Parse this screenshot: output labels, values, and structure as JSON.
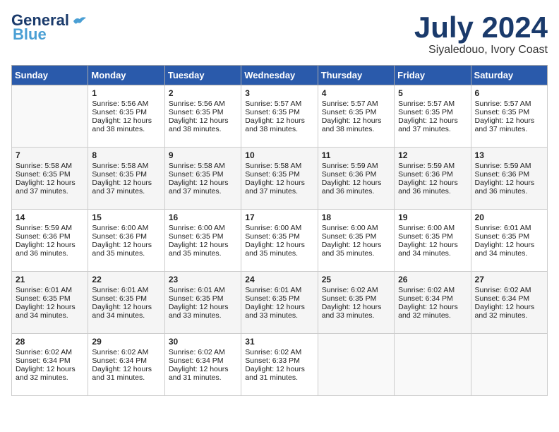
{
  "header": {
    "logo_line1": "General",
    "logo_line2": "Blue",
    "month": "July 2024",
    "location": "Siyaledouo, Ivory Coast"
  },
  "weekdays": [
    "Sunday",
    "Monday",
    "Tuesday",
    "Wednesday",
    "Thursday",
    "Friday",
    "Saturday"
  ],
  "weeks": [
    [
      {
        "day": "",
        "sunrise": "",
        "sunset": "",
        "daylight": ""
      },
      {
        "day": "1",
        "sunrise": "Sunrise: 5:56 AM",
        "sunset": "Sunset: 6:35 PM",
        "daylight": "Daylight: 12 hours and 38 minutes."
      },
      {
        "day": "2",
        "sunrise": "Sunrise: 5:56 AM",
        "sunset": "Sunset: 6:35 PM",
        "daylight": "Daylight: 12 hours and 38 minutes."
      },
      {
        "day": "3",
        "sunrise": "Sunrise: 5:57 AM",
        "sunset": "Sunset: 6:35 PM",
        "daylight": "Daylight: 12 hours and 38 minutes."
      },
      {
        "day": "4",
        "sunrise": "Sunrise: 5:57 AM",
        "sunset": "Sunset: 6:35 PM",
        "daylight": "Daylight: 12 hours and 38 minutes."
      },
      {
        "day": "5",
        "sunrise": "Sunrise: 5:57 AM",
        "sunset": "Sunset: 6:35 PM",
        "daylight": "Daylight: 12 hours and 37 minutes."
      },
      {
        "day": "6",
        "sunrise": "Sunrise: 5:57 AM",
        "sunset": "Sunset: 6:35 PM",
        "daylight": "Daylight: 12 hours and 37 minutes."
      }
    ],
    [
      {
        "day": "7",
        "sunrise": "Sunrise: 5:58 AM",
        "sunset": "Sunset: 6:35 PM",
        "daylight": "Daylight: 12 hours and 37 minutes."
      },
      {
        "day": "8",
        "sunrise": "Sunrise: 5:58 AM",
        "sunset": "Sunset: 6:35 PM",
        "daylight": "Daylight: 12 hours and 37 minutes."
      },
      {
        "day": "9",
        "sunrise": "Sunrise: 5:58 AM",
        "sunset": "Sunset: 6:35 PM",
        "daylight": "Daylight: 12 hours and 37 minutes."
      },
      {
        "day": "10",
        "sunrise": "Sunrise: 5:58 AM",
        "sunset": "Sunset: 6:35 PM",
        "daylight": "Daylight: 12 hours and 37 minutes."
      },
      {
        "day": "11",
        "sunrise": "Sunrise: 5:59 AM",
        "sunset": "Sunset: 6:36 PM",
        "daylight": "Daylight: 12 hours and 36 minutes."
      },
      {
        "day": "12",
        "sunrise": "Sunrise: 5:59 AM",
        "sunset": "Sunset: 6:36 PM",
        "daylight": "Daylight: 12 hours and 36 minutes."
      },
      {
        "day": "13",
        "sunrise": "Sunrise: 5:59 AM",
        "sunset": "Sunset: 6:36 PM",
        "daylight": "Daylight: 12 hours and 36 minutes."
      }
    ],
    [
      {
        "day": "14",
        "sunrise": "Sunrise: 5:59 AM",
        "sunset": "Sunset: 6:36 PM",
        "daylight": "Daylight: 12 hours and 36 minutes."
      },
      {
        "day": "15",
        "sunrise": "Sunrise: 6:00 AM",
        "sunset": "Sunset: 6:36 PM",
        "daylight": "Daylight: 12 hours and 35 minutes."
      },
      {
        "day": "16",
        "sunrise": "Sunrise: 6:00 AM",
        "sunset": "Sunset: 6:35 PM",
        "daylight": "Daylight: 12 hours and 35 minutes."
      },
      {
        "day": "17",
        "sunrise": "Sunrise: 6:00 AM",
        "sunset": "Sunset: 6:35 PM",
        "daylight": "Daylight: 12 hours and 35 minutes."
      },
      {
        "day": "18",
        "sunrise": "Sunrise: 6:00 AM",
        "sunset": "Sunset: 6:35 PM",
        "daylight": "Daylight: 12 hours and 35 minutes."
      },
      {
        "day": "19",
        "sunrise": "Sunrise: 6:00 AM",
        "sunset": "Sunset: 6:35 PM",
        "daylight": "Daylight: 12 hours and 34 minutes."
      },
      {
        "day": "20",
        "sunrise": "Sunrise: 6:01 AM",
        "sunset": "Sunset: 6:35 PM",
        "daylight": "Daylight: 12 hours and 34 minutes."
      }
    ],
    [
      {
        "day": "21",
        "sunrise": "Sunrise: 6:01 AM",
        "sunset": "Sunset: 6:35 PM",
        "daylight": "Daylight: 12 hours and 34 minutes."
      },
      {
        "day": "22",
        "sunrise": "Sunrise: 6:01 AM",
        "sunset": "Sunset: 6:35 PM",
        "daylight": "Daylight: 12 hours and 34 minutes."
      },
      {
        "day": "23",
        "sunrise": "Sunrise: 6:01 AM",
        "sunset": "Sunset: 6:35 PM",
        "daylight": "Daylight: 12 hours and 33 minutes."
      },
      {
        "day": "24",
        "sunrise": "Sunrise: 6:01 AM",
        "sunset": "Sunset: 6:35 PM",
        "daylight": "Daylight: 12 hours and 33 minutes."
      },
      {
        "day": "25",
        "sunrise": "Sunrise: 6:02 AM",
        "sunset": "Sunset: 6:35 PM",
        "daylight": "Daylight: 12 hours and 33 minutes."
      },
      {
        "day": "26",
        "sunrise": "Sunrise: 6:02 AM",
        "sunset": "Sunset: 6:34 PM",
        "daylight": "Daylight: 12 hours and 32 minutes."
      },
      {
        "day": "27",
        "sunrise": "Sunrise: 6:02 AM",
        "sunset": "Sunset: 6:34 PM",
        "daylight": "Daylight: 12 hours and 32 minutes."
      }
    ],
    [
      {
        "day": "28",
        "sunrise": "Sunrise: 6:02 AM",
        "sunset": "Sunset: 6:34 PM",
        "daylight": "Daylight: 12 hours and 32 minutes."
      },
      {
        "day": "29",
        "sunrise": "Sunrise: 6:02 AM",
        "sunset": "Sunset: 6:34 PM",
        "daylight": "Daylight: 12 hours and 31 minutes."
      },
      {
        "day": "30",
        "sunrise": "Sunrise: 6:02 AM",
        "sunset": "Sunset: 6:34 PM",
        "daylight": "Daylight: 12 hours and 31 minutes."
      },
      {
        "day": "31",
        "sunrise": "Sunrise: 6:02 AM",
        "sunset": "Sunset: 6:33 PM",
        "daylight": "Daylight: 12 hours and 31 minutes."
      },
      {
        "day": "",
        "sunrise": "",
        "sunset": "",
        "daylight": ""
      },
      {
        "day": "",
        "sunrise": "",
        "sunset": "",
        "daylight": ""
      },
      {
        "day": "",
        "sunrise": "",
        "sunset": "",
        "daylight": ""
      }
    ]
  ]
}
